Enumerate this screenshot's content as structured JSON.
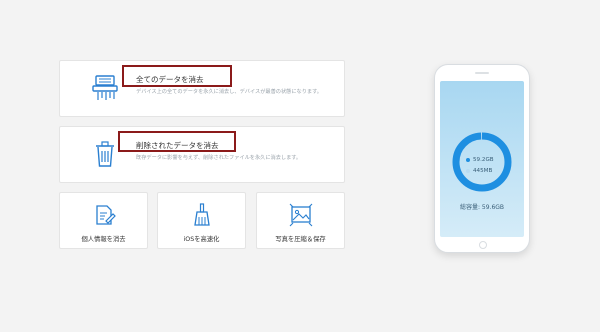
{
  "actions": {
    "erase_all": {
      "title": "全てのデータを消去",
      "description": "デバイス上の全てのデータを永久に消去し、デバイスが最善の状態になります。"
    },
    "erase_deleted": {
      "title": "削除されたデータを消去",
      "description": "既存データに影響を与えず、削除されたファイルを永久に消去します。"
    },
    "erase_private": {
      "label": "個人情報を消去"
    },
    "speed_up": {
      "label": "iOSを高速化"
    },
    "compress_photos": {
      "label": "写真を圧縮＆保存"
    }
  },
  "storage": {
    "used_label": "59.2GB",
    "free_label": "445MB",
    "total_label": "総容量: 59.6GB",
    "used_fraction": 0.9927,
    "used_color": "#1e8fe1",
    "free_color": "#b7dcf2"
  },
  "colors": {
    "accent": "#1e8fe1",
    "highlight": "#8b1a1a"
  }
}
